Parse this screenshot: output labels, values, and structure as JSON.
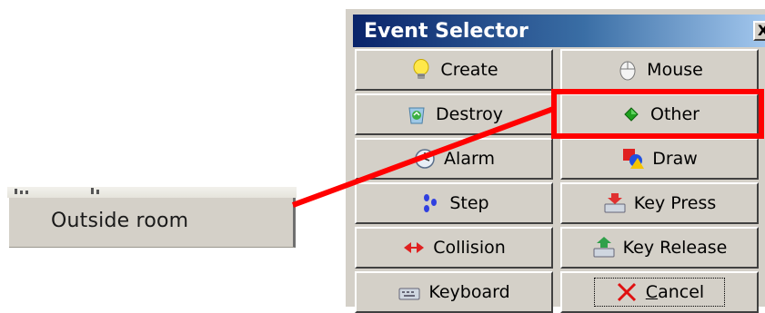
{
  "context_menu": {
    "item_label": "Outside room"
  },
  "dialog": {
    "title": "Event Selector",
    "close_glyph": "X",
    "buttons": [
      {
        "label": "Create",
        "icon": "lightbulb-icon"
      },
      {
        "label": "Mouse",
        "icon": "mouse-icon"
      },
      {
        "label": "Destroy",
        "icon": "recycle-bin-icon"
      },
      {
        "label": "Other",
        "icon": "green-diamond-icon"
      },
      {
        "label": "Alarm",
        "icon": "clock-icon"
      },
      {
        "label": "Draw",
        "icon": "shapes-icon"
      },
      {
        "label": "Step",
        "icon": "footsteps-icon"
      },
      {
        "label": "Key Press",
        "icon": "keyboard-down-icon"
      },
      {
        "label": "Collision",
        "icon": "collision-arrows-icon"
      },
      {
        "label": "Key Release",
        "icon": "keyboard-up-icon"
      },
      {
        "label": "Keyboard",
        "icon": "keyboard-icon"
      },
      {
        "label": "Cancel",
        "icon": "red-x-icon",
        "accesskey": "C"
      }
    ],
    "cancel_first": "C",
    "cancel_rest": "ancel"
  },
  "annotation": {
    "color": "#ff0000",
    "highlighted_button": "Other"
  }
}
